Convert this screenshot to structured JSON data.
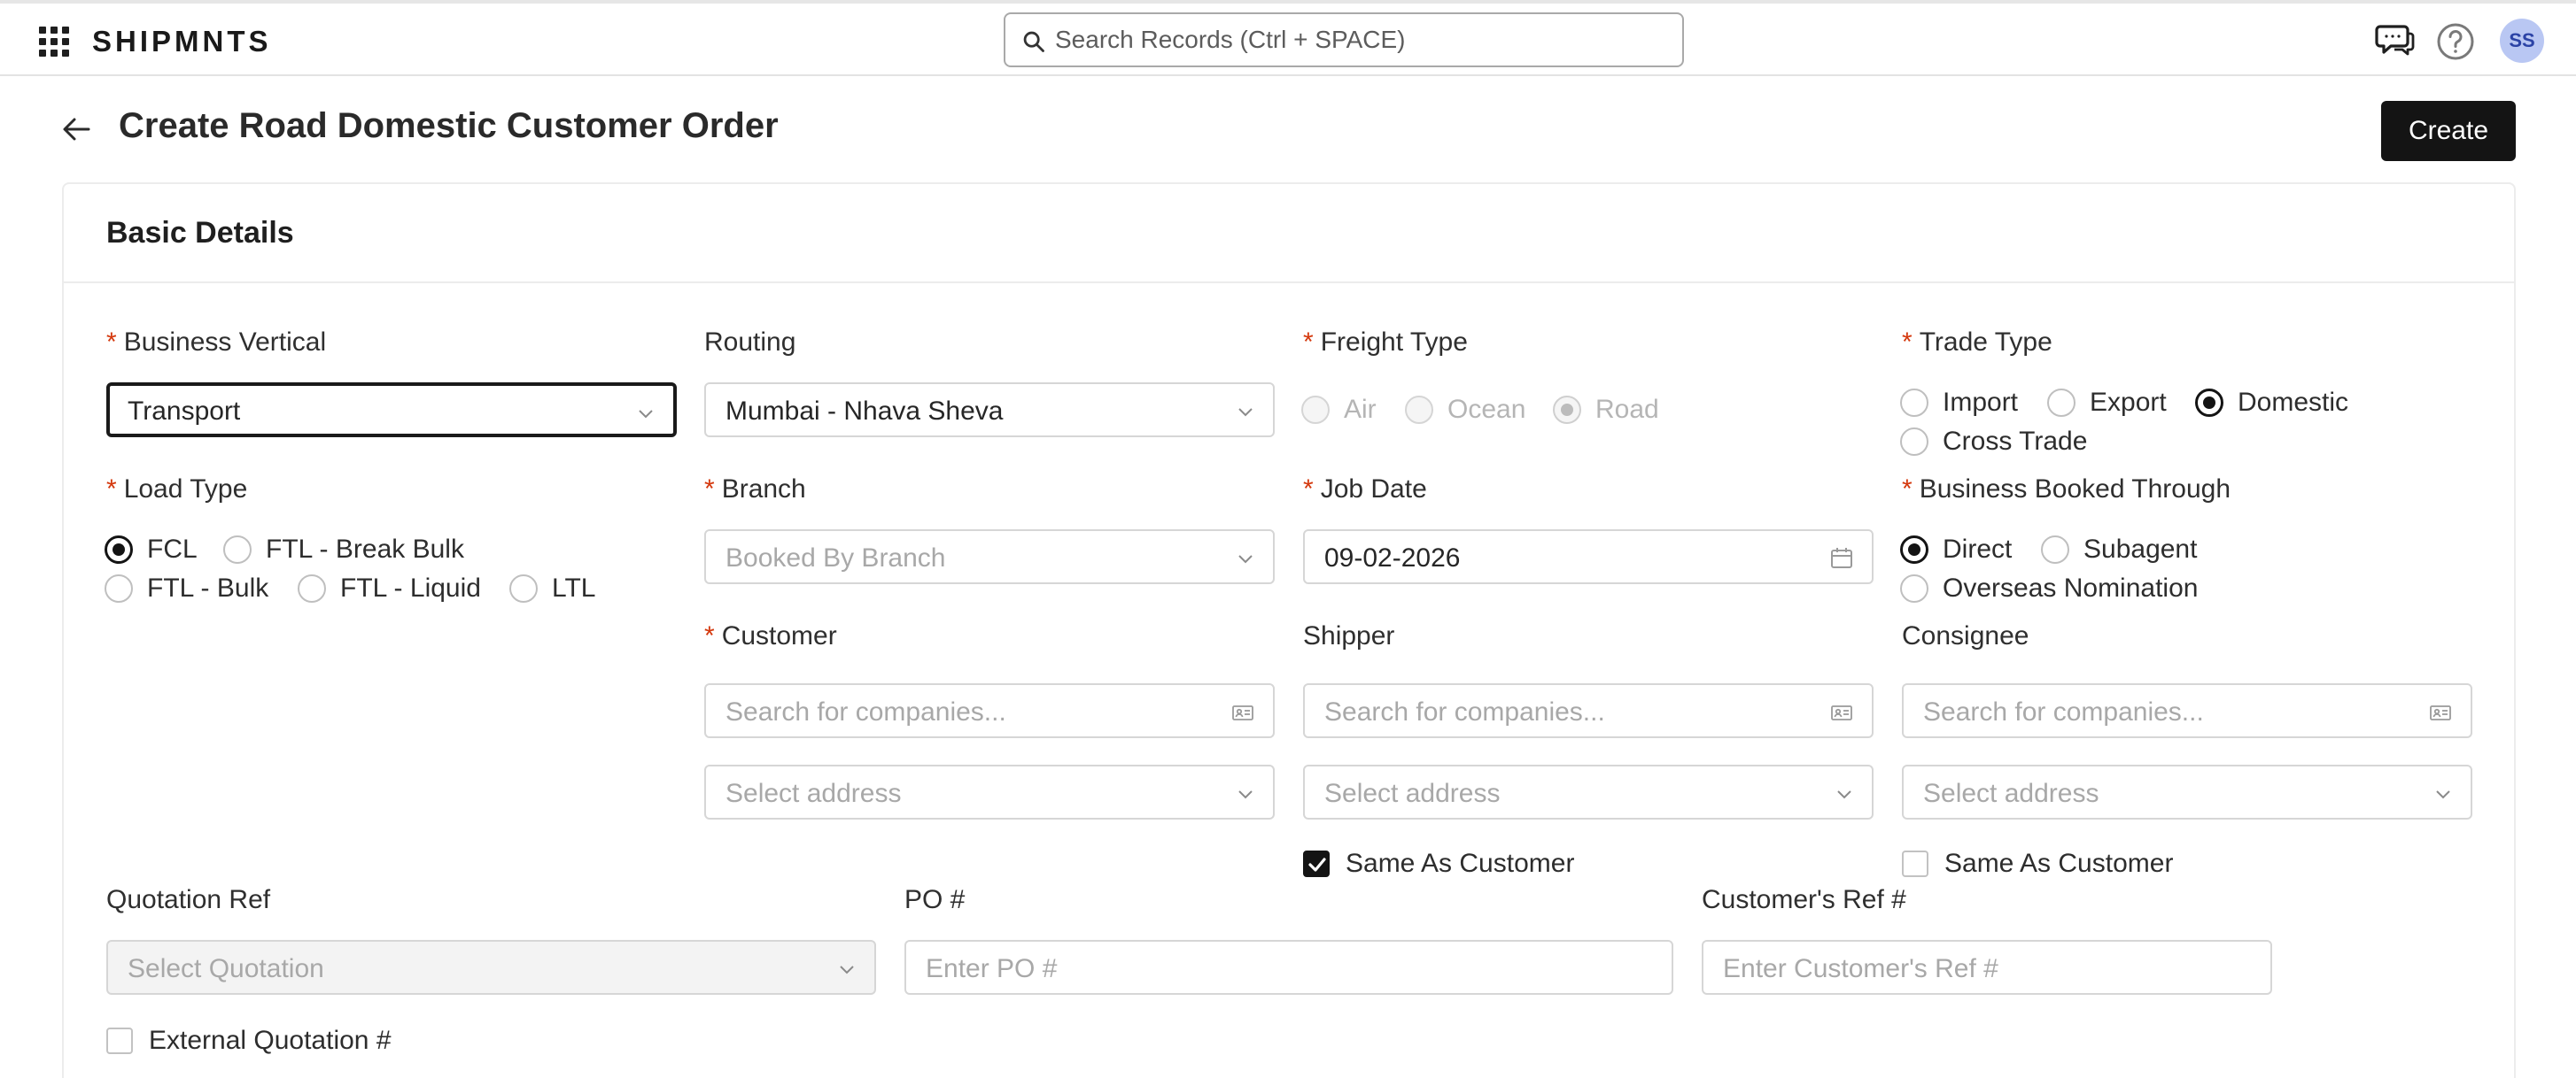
{
  "app": {
    "brand": "SHIPMNTS",
    "user_initials": "SS"
  },
  "search": {
    "placeholder": "Search Records (Ctrl + SPACE)"
  },
  "page": {
    "title": "Create Road Domestic Customer Order",
    "create_label": "Create"
  },
  "section": {
    "title": "Basic Details"
  },
  "form": {
    "business_vertical": {
      "label": "Business Vertical",
      "required": "*",
      "value": "Transport"
    },
    "routing": {
      "label": "Routing",
      "value": "Mumbai - Nhava Sheva"
    },
    "freight_type": {
      "label": "Freight Type",
      "required": "*",
      "options": [
        "Air",
        "Ocean",
        "Road"
      ],
      "selected": "Road",
      "disabled": true
    },
    "trade_type": {
      "label": "Trade Type",
      "required": "*",
      "options": [
        "Import",
        "Export",
        "Domestic",
        "Cross Trade"
      ],
      "selected": "Domestic"
    },
    "load_type": {
      "label": "Load Type",
      "required": "*",
      "options": [
        "FCL",
        "FTL - Break Bulk",
        "FTL - Bulk",
        "FTL - Liquid",
        "LTL"
      ],
      "selected": "FCL"
    },
    "branch": {
      "label": "Branch",
      "required": "*",
      "placeholder": "Booked By Branch"
    },
    "job_date": {
      "label": "Job Date",
      "required": "*",
      "value": "09-02-2026"
    },
    "business_booked_through": {
      "label": "Business Booked Through",
      "required": "*",
      "options": [
        "Direct",
        "Subagent",
        "Overseas Nomination"
      ],
      "selected": "Direct"
    },
    "customer": {
      "label": "Customer",
      "required": "*",
      "placeholder": "Search for companies...",
      "address_placeholder": "Select address"
    },
    "shipper": {
      "label": "Shipper",
      "placeholder": "Search for companies...",
      "address_placeholder": "Select address",
      "same_as_customer": "Same As Customer",
      "same_as_customer_checked": true
    },
    "consignee": {
      "label": "Consignee",
      "placeholder": "Search for companies...",
      "address_placeholder": "Select address",
      "same_as_customer": "Same As Customer",
      "same_as_customer_checked": false
    },
    "quotation_ref": {
      "label": "Quotation Ref",
      "placeholder": "Select Quotation",
      "disabled": true
    },
    "po_number": {
      "label": "PO #",
      "placeholder": "Enter PO #"
    },
    "customer_ref": {
      "label": "Customer's Ref #",
      "placeholder": "Enter Customer's Ref #"
    },
    "external_quotation": {
      "label": "External Quotation #",
      "checked": false
    }
  },
  "icons": {
    "apps": "grid-icon",
    "search": "search-icon",
    "chat": "chat-icon",
    "help": "help-icon",
    "back": "arrow-left-icon",
    "dropdown": "chevron-down-icon",
    "calendar": "calendar-icon",
    "company_card": "id-card-icon"
  },
  "colors": {
    "primary_button": "#141414",
    "required_marker": "#d4380d",
    "avatar_bg": "#b9c7f3"
  }
}
